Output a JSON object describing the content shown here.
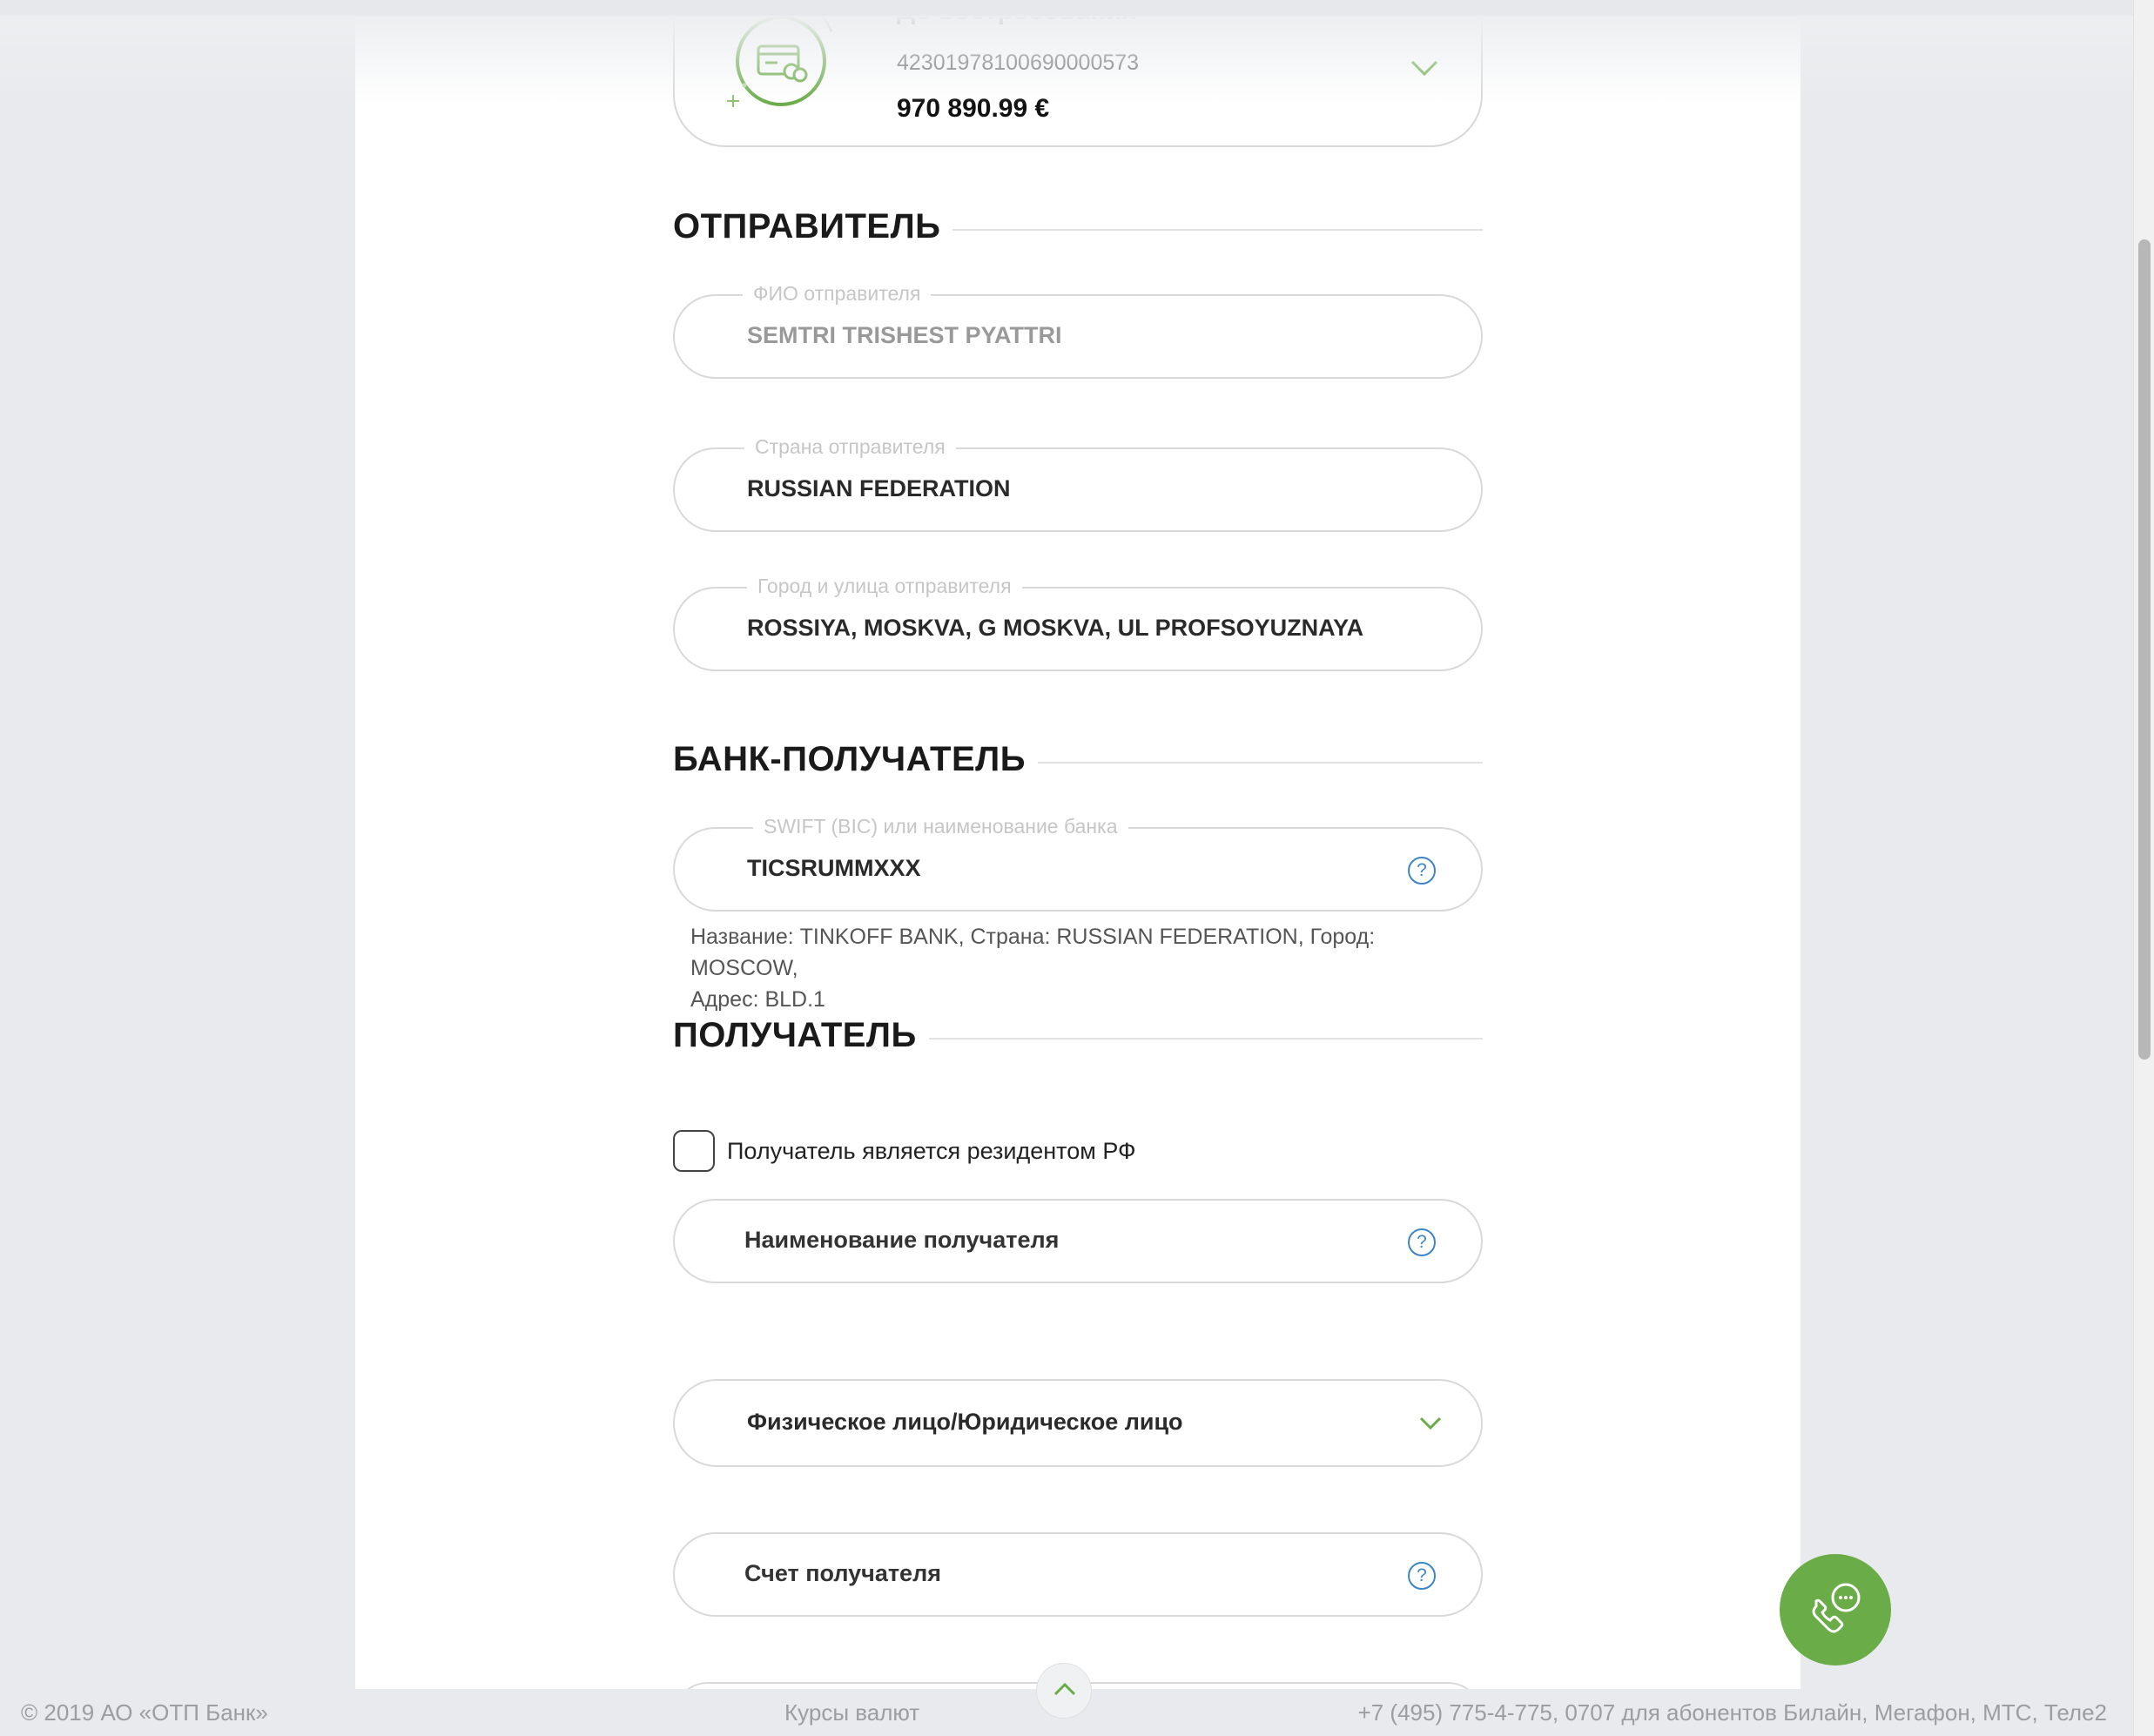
{
  "account": {
    "name": "До востребования",
    "number": "42301978100690000573",
    "amount": "970 890.99 €"
  },
  "sender": {
    "heading": "ОТПРАВИТЕЛЬ",
    "name_label": "ФИО отправителя",
    "name_value": "SEMTRI TRISHEST PYATTRI",
    "country_label": "Страна отправителя",
    "country_value": "RUSSIAN FEDERATION",
    "address_label": "Город и улица отправителя",
    "address_value": "ROSSIYA, MOSKVA, G MOSKVA, UL PROFSOYUZNAYA"
  },
  "bank": {
    "heading": "БАНК-ПОЛУЧАТЕЛЬ",
    "swift_label": "SWIFT (BIC) или наименование банка",
    "swift_value": "TICSRUMMXXX",
    "info_line1": "Название: TINKOFF BANK, Страна: RUSSIAN FEDERATION, Город: MOSCOW,",
    "info_line2": "Адрес: BLD.1"
  },
  "recipient": {
    "heading": "ПОЛУЧАТЕЛЬ",
    "resident_label": "Получатель является резидентом РФ",
    "resident_checked": false,
    "name_placeholder": "Наименование получателя",
    "type_select": "Физическое лицо/Юридическое лицо",
    "account_placeholder": "Счет получателя"
  },
  "footer": {
    "copyright": "© 2019 АО «ОТП Банк»",
    "rates_link": "Курсы валют",
    "phones": "+7 (495) 775-4-775,  0707 для абонентов Билайн, Мегафон, МТС, Теле2"
  },
  "icons": {
    "help": "?",
    "accent_color": "#6aac48",
    "help_color": "#3d86c6"
  }
}
